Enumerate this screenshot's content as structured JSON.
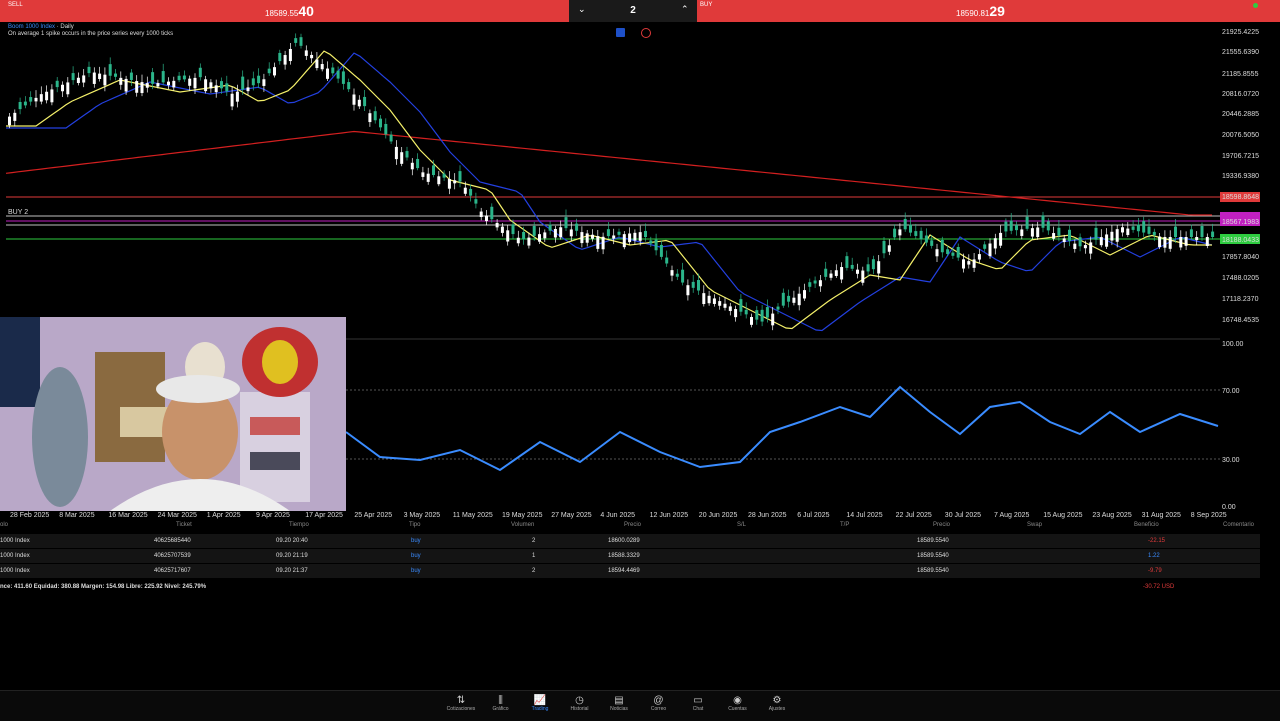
{
  "top": {
    "sell_label": "SELL",
    "sell_price_main": "18589.55",
    "sell_price_big": "40",
    "buy_label": "BUY",
    "buy_price_main": "18590.81",
    "buy_price_big": "29",
    "lot_value": "2",
    "down_arrow": "⌄",
    "up_arrow": "⌃"
  },
  "chart": {
    "symbol": "Boom 1000 Index",
    "separator": " · ",
    "timeframe": "Daily",
    "description": "On average 1 spike occurs in the price series every 1000 ticks",
    "buy_line_label": "BUY 2",
    "price_labels": [
      "21925.4225",
      "21555.6390",
      "21185.8555",
      "20816.0720",
      "20446.2885",
      "20076.5050",
      "19706.7215",
      "19336.9380",
      "18598.8648",
      "18567.1983",
      "18188.0433",
      "17857.8040",
      "17488.0205",
      "17118.2370",
      "16748.4535"
    ],
    "osc_labels": [
      "100.00",
      "70.00",
      "30.00",
      "0.00"
    ],
    "date_labels": [
      "28 Feb 2025",
      "8 Mar 2025",
      "16 Mar 2025",
      "24 Mar 2025",
      "1 Apr 2025",
      "9 Apr 2025",
      "17 Apr 2025",
      "25 Apr 2025",
      "3 May 2025",
      "11 May 2025",
      "19 May 2025",
      "27 May 2025",
      "4 Jun 2025",
      "12 Jun 2025",
      "20 Jun 2025",
      "28 Jun 2025",
      "6 Jul 2025",
      "14 Jul 2025",
      "22 Jul 2025",
      "30 Jul 2025",
      "7 Aug 2025",
      "15 Aug 2025",
      "23 Aug 2025",
      "31 Aug 2025",
      "8 Sep 2025"
    ],
    "colors": {
      "bull": "#2bb58a",
      "bear": "#ffffff",
      "ma_fast": "#f4f06a",
      "ma_mid": "#2340e0",
      "ma_slow": "#d42020",
      "osc": "#3a8cff",
      "buy_line": "#2ecc40",
      "sl_line": "#e03a3a",
      "magenta": "#c020c0"
    }
  },
  "table": {
    "headers": [
      "olo",
      "Ticket",
      "Tiempo",
      "Tipo",
      "Volumen",
      "Precio",
      "S/L",
      "T/P",
      "Precio",
      "Swap",
      "Beneficio",
      "Comentario"
    ],
    "rows": [
      {
        "symbol": "1000 Index",
        "ticket": "40625685440",
        "time": "09.20 20:40",
        "type": "buy",
        "volume": "2",
        "price": "18600.0289",
        "cur_price": "18589.5540",
        "profit": "-22.15",
        "profit_color": "#e03a3a"
      },
      {
        "symbol": "1000 Index",
        "ticket": "40625707539",
        "time": "09.20 21:19",
        "type": "buy",
        "volume": "1",
        "price": "18588.3329",
        "cur_price": "18589.5540",
        "profit": "1.22",
        "profit_color": "#3a8cff"
      },
      {
        "symbol": "1000 Index",
        "ticket": "40625717607",
        "time": "09.20 21:37",
        "type": "buy",
        "volume": "2",
        "price": "18594.4469",
        "cur_price": "18589.5540",
        "profit": "-9.79",
        "profit_color": "#e03a3a"
      }
    ],
    "summary": "nce: 411.60 Equidad: 380.88 Margen: 154.98 Libre: 225.92 Nivel: 245.79%",
    "total": "-30.72  USD"
  },
  "nav": [
    {
      "label": "Cotizaciones",
      "icon": "⇅"
    },
    {
      "label": "Gráfico",
      "icon": "⫼"
    },
    {
      "label": "Trading",
      "icon": "📈"
    },
    {
      "label": "Historial",
      "icon": "◷"
    },
    {
      "label": "Noticias",
      "icon": "▤"
    },
    {
      "label": "Correo",
      "icon": "@"
    },
    {
      "label": "Chat",
      "icon": "▭"
    },
    {
      "label": "Cuentas",
      "icon": "◉"
    },
    {
      "label": "Ajustes",
      "icon": "⚙"
    }
  ]
}
